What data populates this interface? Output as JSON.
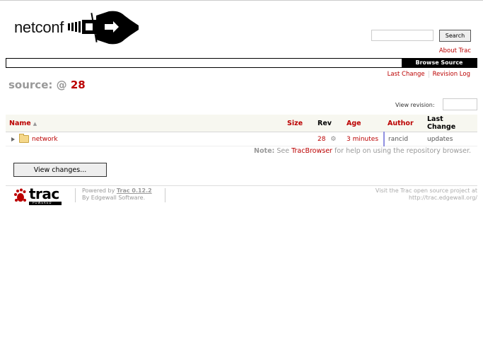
{
  "header": {
    "logo_text": "netconf",
    "search_button": "Search",
    "about_link": "About Trac"
  },
  "mainnav": {
    "active_item": "Browse Source"
  },
  "ctxnav": {
    "items": [
      "Last Change",
      "Revision Log"
    ]
  },
  "page": {
    "title_prefix": "source: @",
    "revision": "28",
    "view_revision_label": "View revision:",
    "view_revision_value": ""
  },
  "table": {
    "headers": {
      "name": "Name",
      "name_sort_icon": "▲",
      "size": "Size",
      "rev": "Rev",
      "age": "Age",
      "author": "Author",
      "last_change": "Last Change"
    },
    "rows": [
      {
        "name": "network",
        "size": "",
        "rev": "28",
        "rev_icon": "⚙",
        "age": "3 minutes",
        "author": "rancid",
        "last_change": "updates"
      }
    ]
  },
  "note": {
    "label": "Note:",
    "text_before": "See",
    "link": "TracBrowser",
    "text_after": "for help on using the repository browser."
  },
  "view_changes_button": "View changes...",
  "footer": {
    "trac_logo_text": "trac",
    "trac_logo_sub": "POWERED",
    "powered_prefix": "Powered by",
    "powered_link": "Trac 0.12.2",
    "powered_by_line2": "By Edgewall Software.",
    "visit_line1": "Visit the Trac open source project at",
    "visit_line2": "http://trac.edgewall.org/"
  },
  "colors": {
    "link": "#bb0000",
    "nav_active_bg": "#000000",
    "title_gray": "#999999"
  }
}
